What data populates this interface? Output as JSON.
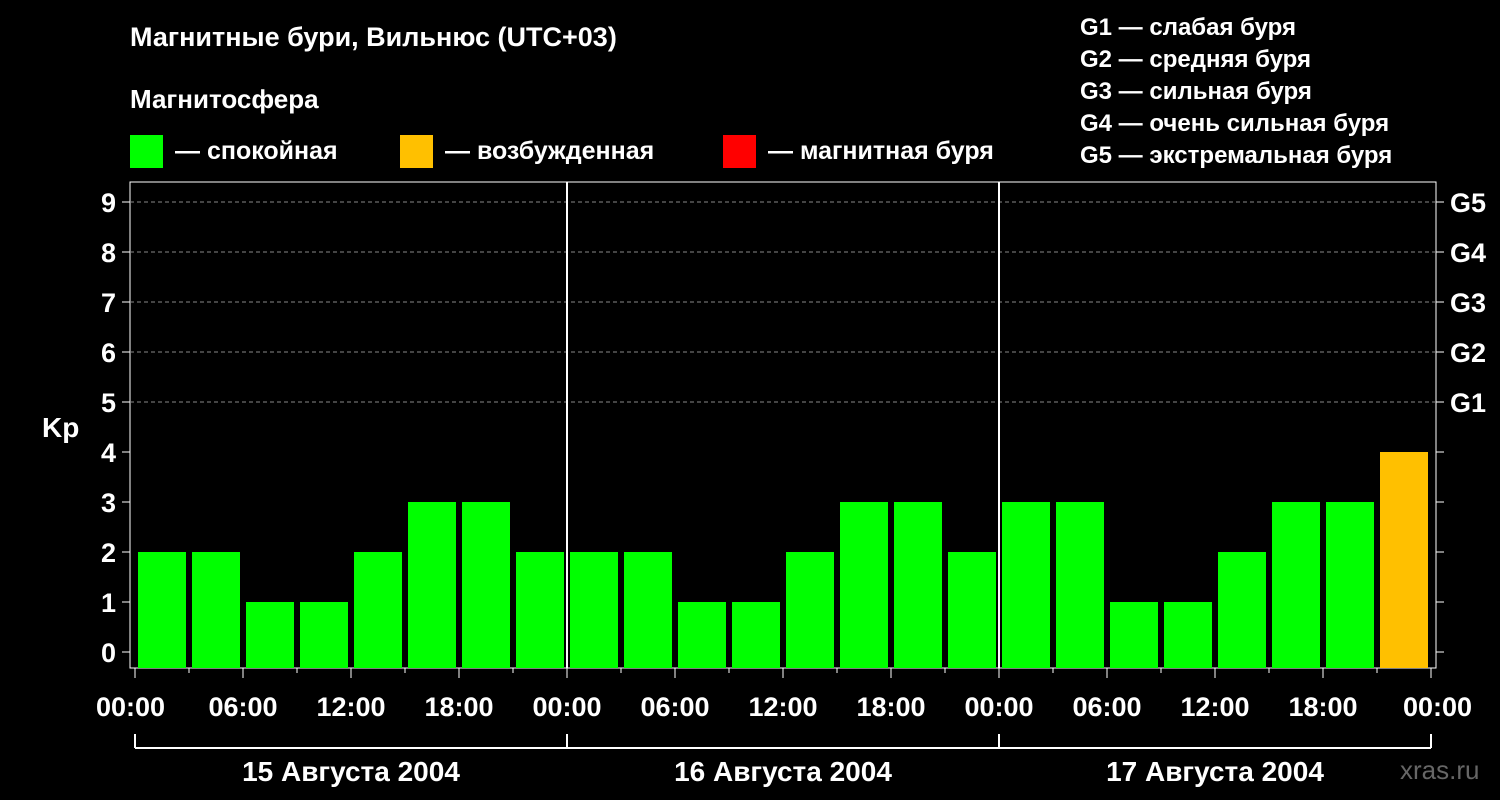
{
  "header": {
    "title": "Магнитные бури, Вильнюс (UTC+03)",
    "subtitle": "Магнитосфера"
  },
  "legend": [
    {
      "label": "— спокойная",
      "color": "#00ff00"
    },
    {
      "label": "— возбужденная",
      "color": "#ffc000"
    },
    {
      "label": "— магнитная буря",
      "color": "#ff0000"
    }
  ],
  "storm_levels": [
    "G1 — слабая буря",
    "G2 — средняя буря",
    "G3 — сильная буря",
    "G4 — очень сильная буря",
    "G5 — экстремальная буря"
  ],
  "watermark": "xras.ru",
  "chart_data": {
    "type": "bar",
    "ylabel": "Kp",
    "ylim": [
      0,
      9
    ],
    "yticks": [
      "0",
      "1",
      "2",
      "3",
      "4",
      "5",
      "6",
      "7",
      "8",
      "9"
    ],
    "right_ticks": [
      {
        "value": 5,
        "label": "G1"
      },
      {
        "value": 6,
        "label": "G2"
      },
      {
        "value": 7,
        "label": "G3"
      },
      {
        "value": 8,
        "label": "G4"
      },
      {
        "value": 9,
        "label": "G5"
      }
    ],
    "x_tick_labels": [
      "00:00",
      "06:00",
      "12:00",
      "18:00",
      "00:00",
      "06:00",
      "12:00",
      "18:00",
      "00:00",
      "06:00",
      "12:00",
      "18:00",
      "00:00"
    ],
    "days": [
      "15 Августа 2004",
      "16 Августа 2004",
      "17 Августа 2004"
    ],
    "interval_hours": 3,
    "values": [
      2,
      2,
      1,
      1,
      2,
      3,
      3,
      2,
      2,
      2,
      1,
      1,
      2,
      3,
      3,
      2,
      3,
      3,
      1,
      1,
      2,
      3,
      3,
      4
    ],
    "colors": [
      "#00ff00",
      "#00ff00",
      "#00ff00",
      "#00ff00",
      "#00ff00",
      "#00ff00",
      "#00ff00",
      "#00ff00",
      "#00ff00",
      "#00ff00",
      "#00ff00",
      "#00ff00",
      "#00ff00",
      "#00ff00",
      "#00ff00",
      "#00ff00",
      "#00ff00",
      "#00ff00",
      "#00ff00",
      "#00ff00",
      "#00ff00",
      "#00ff00",
      "#00ff00",
      "#ffc000"
    ],
    "grid": true,
    "legend_position": "top"
  }
}
